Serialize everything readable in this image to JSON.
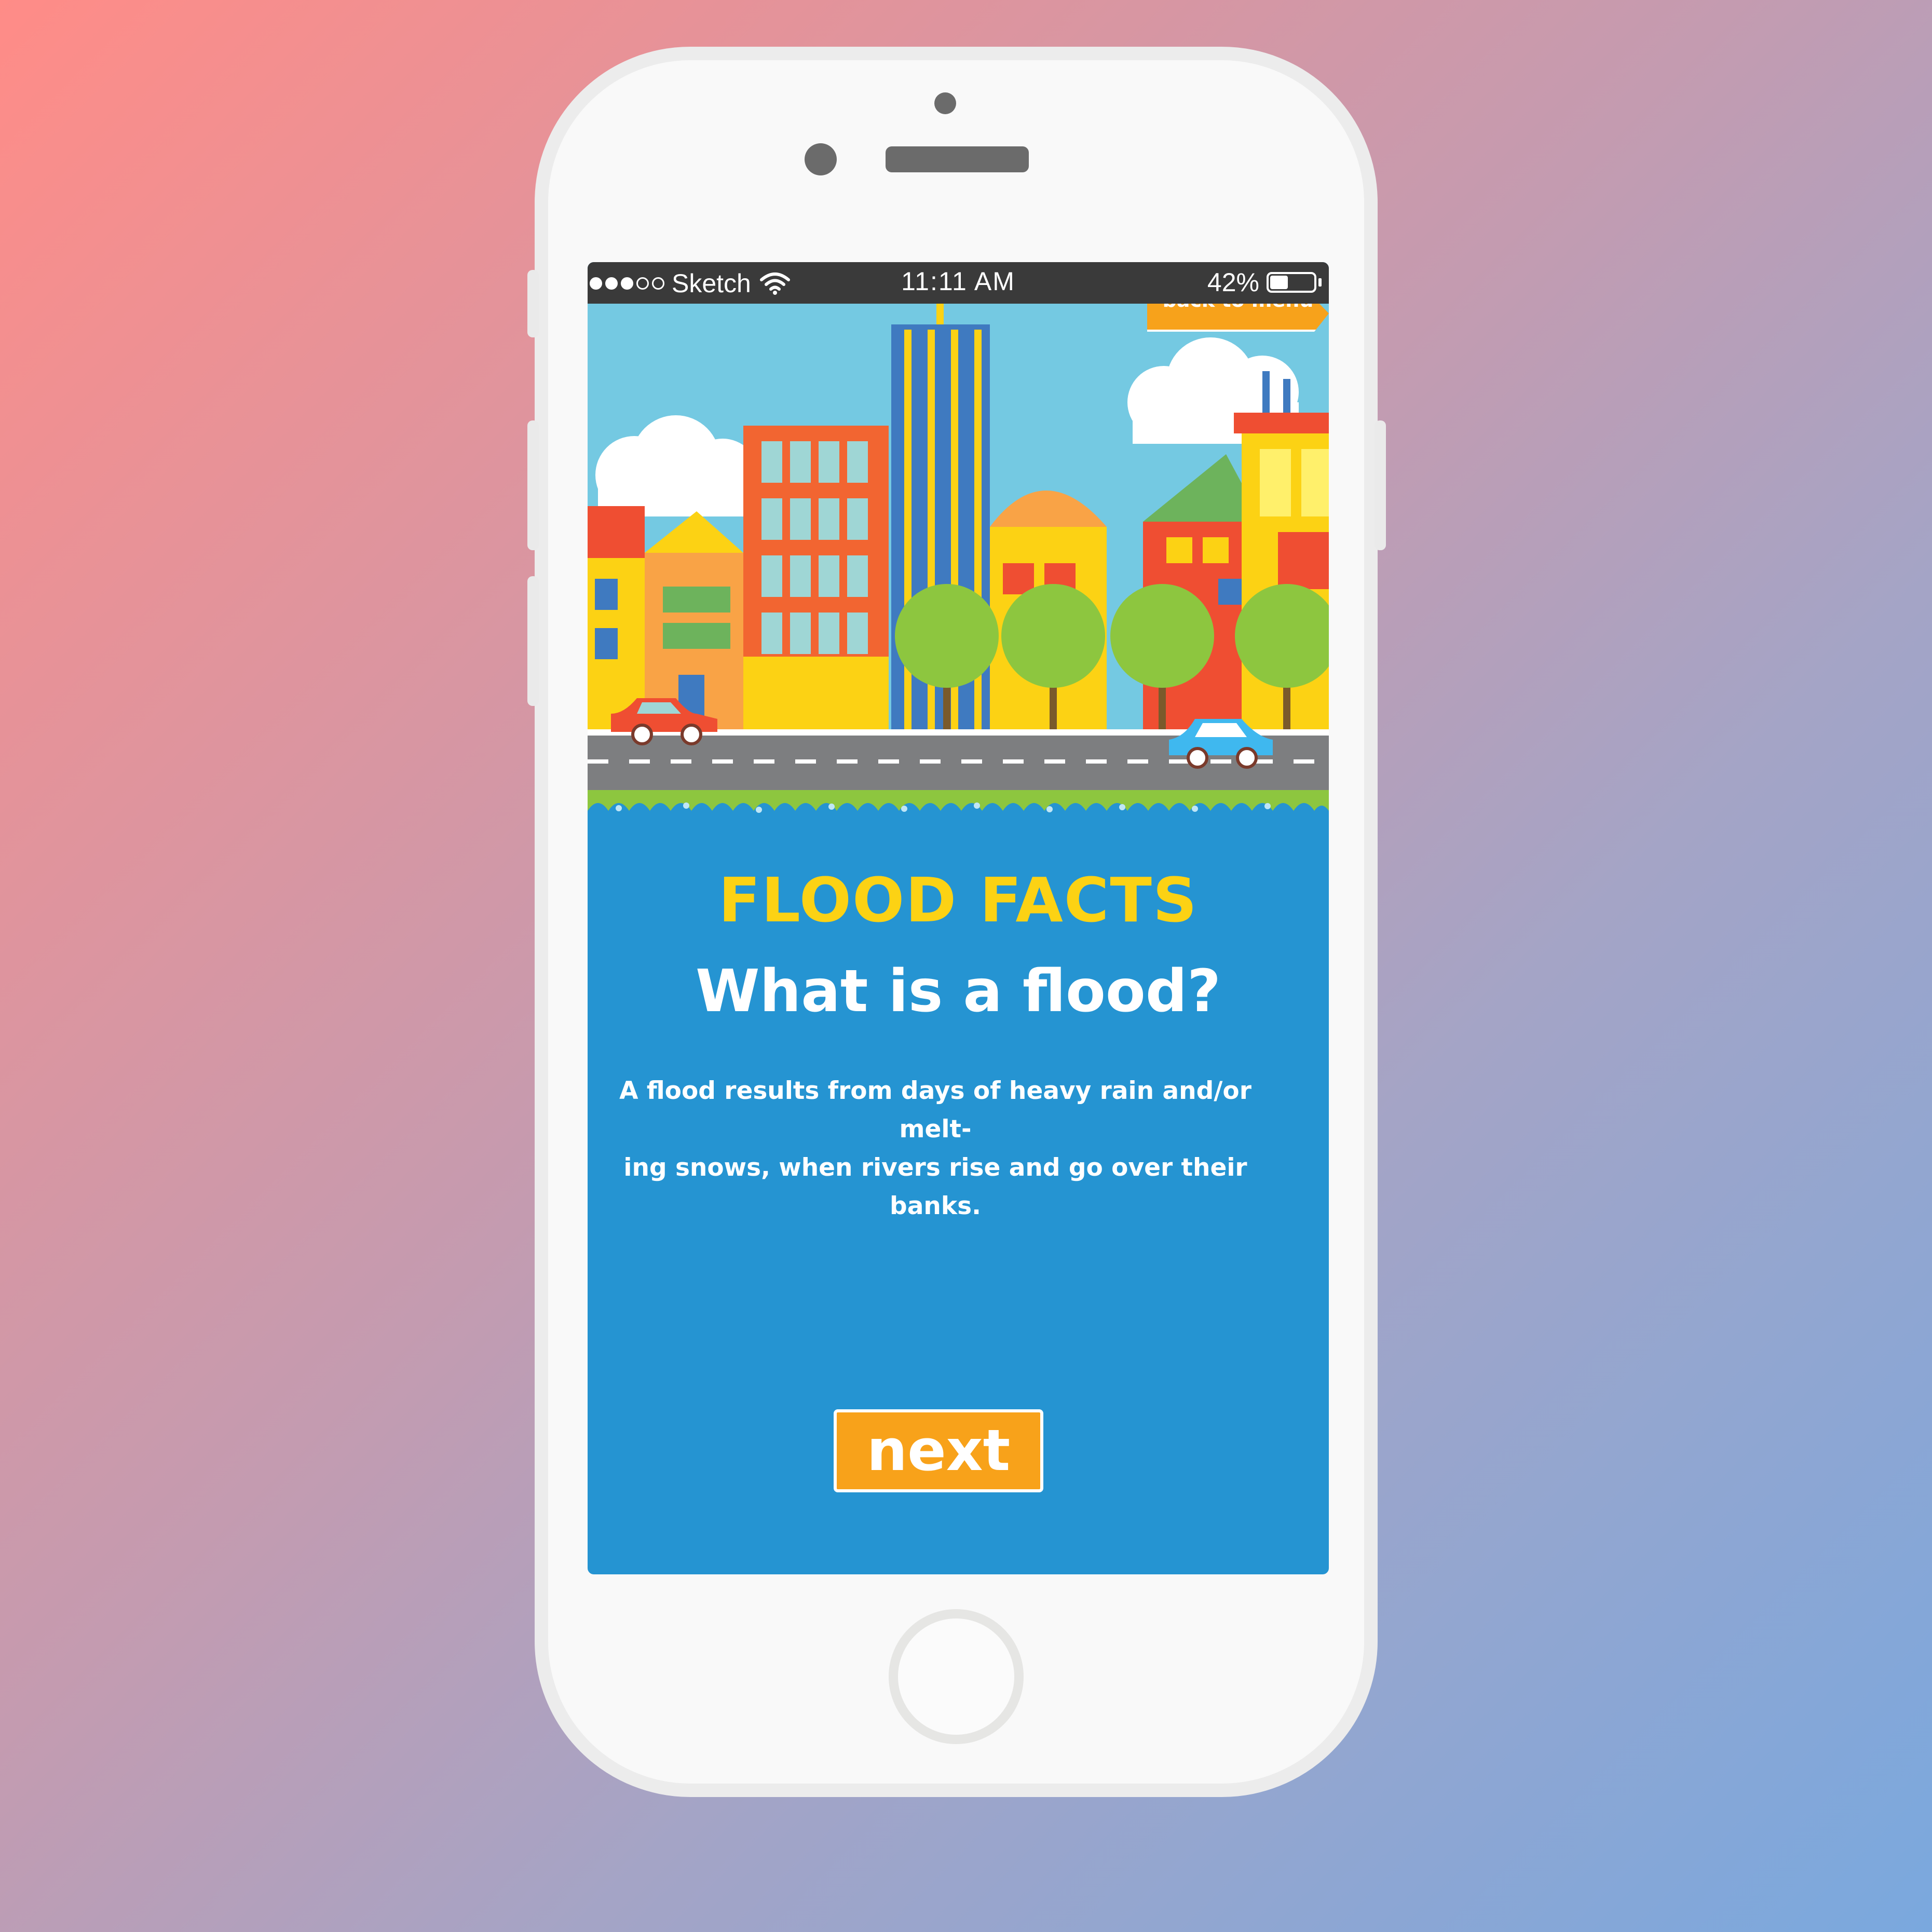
{
  "status_bar": {
    "carrier": "Sketch",
    "time": "11:11 AM",
    "battery": "42%",
    "battery_level": 0.42,
    "signal_bars_filled": 3,
    "signal_bars_total": 5
  },
  "nav": {
    "back_label": "back to menu"
  },
  "content": {
    "section_title": "FLOOD FACTS",
    "question": "What is a flood?",
    "body_line1": "A flood results from days of heavy rain and/or melt-",
    "body_line2": "ing snows, when rivers rise and go over their banks."
  },
  "actions": {
    "next_label": "next"
  },
  "colors": {
    "screen_bg": "#2594d2",
    "title": "#fcd214",
    "button": "#f8a21a",
    "sky": "#74c9e2",
    "grass": "#8dc63f"
  },
  "icons": [
    "wifi-icon",
    "battery-icon",
    "signal-dots-icon"
  ]
}
